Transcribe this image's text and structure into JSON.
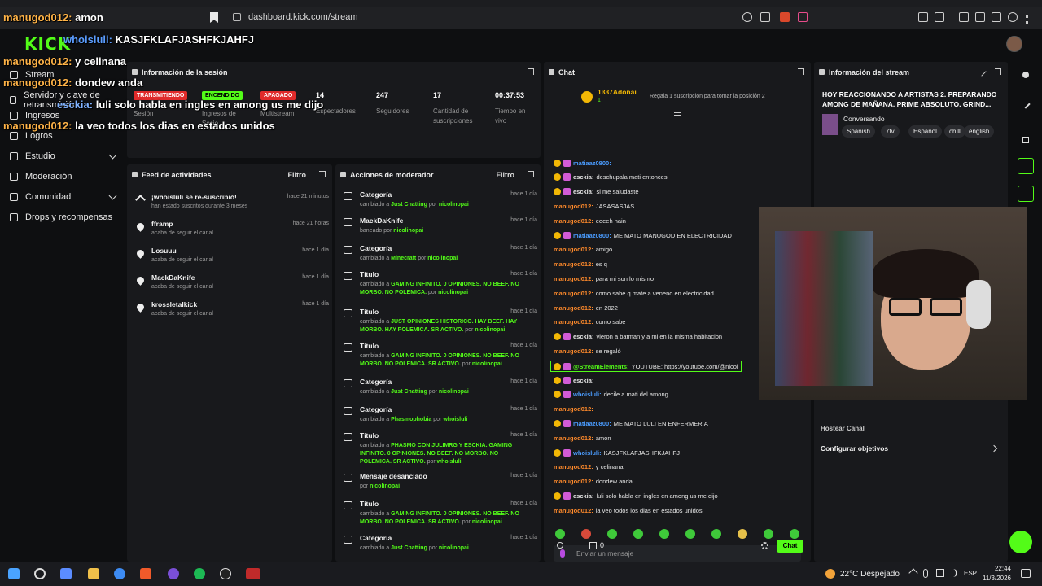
{
  "browser": {
    "url": "dashboard.kick.com/stream",
    "tab_title": "amon"
  },
  "logo": "KICK",
  "sidebar": {
    "items": [
      {
        "label": "Stream"
      },
      {
        "label": "Servidor y clave de retransmisión"
      },
      {
        "label": "Ingresos"
      },
      {
        "label": "Logros"
      },
      {
        "label": "Estudio"
      },
      {
        "label": "Moderación"
      },
      {
        "label": "Comunidad"
      },
      {
        "label": "Drops y recompensas"
      }
    ]
  },
  "session": {
    "title": "Información de la sesión",
    "badges": [
      "TRANSMITIENDO",
      "ENCENDIDO",
      "APAGADO"
    ],
    "badge_labels": [
      "Sesión",
      "Ingresos de Socio",
      "Multistream"
    ],
    "stats": [
      {
        "value": "14",
        "label": "Espectadores"
      },
      {
        "value": "247",
        "label": "Seguidores"
      },
      {
        "value": "17",
        "label": "Cantidad de suscripciones"
      },
      {
        "value": "00:37:53",
        "label": "Tiempo en vivo"
      }
    ]
  },
  "feed": {
    "title": "Feed de actividades",
    "filter_label": "Filtro",
    "items": [
      {
        "name": "¡whoisluli se re-suscribió!",
        "sub": "han estado suscritos durante 3 meses",
        "time": "hace 21 minutos"
      },
      {
        "name": "fframp",
        "sub": "acaba de seguir el canal",
        "time": "hace 21 horas"
      },
      {
        "name": "Losuuu",
        "sub": "acaba de seguir el canal",
        "time": "hace 1 día"
      },
      {
        "name": "MackDaKnife",
        "sub": "acaba de seguir el canal",
        "time": "hace 1 día"
      },
      {
        "name": "krossletalkick",
        "sub": "acaba de seguir el canal",
        "time": "hace 1 día"
      }
    ]
  },
  "mod": {
    "title": "Acciones de moderador",
    "filter_label": "Filtro",
    "items": [
      {
        "title": "Categoría",
        "pre": "cambiado a ",
        "val": "Just Chatting",
        "mid": " por ",
        "by": "nicolinopai",
        "time": "hace 1 día"
      },
      {
        "title": "MackDaKnife",
        "pre": "baneado por ",
        "val": "",
        "mid": "",
        "by": "nicolinopai",
        "time": "hace 1 día"
      },
      {
        "title": "Categoría",
        "pre": "cambiado a ",
        "val": "Minecraft",
        "mid": " por ",
        "by": "nicolinopai",
        "time": "hace 1 día"
      },
      {
        "title": "Título",
        "pre": "cambiado a ",
        "val": "GAMING INFINITO. 0 OPINIONES. NO BEEF. NO MORBO. NO POLEMICA.",
        "mid": " por ",
        "by": "nicolinopai",
        "time": "hace 1 día"
      },
      {
        "title": "Título",
        "pre": "cambiado a ",
        "val": "JUST OPINIONES HISTORICO. HAY BEEF. HAY MORBO. HAY POLEMICA. SR ACTIVO.",
        "mid": " por ",
        "by": "nicolinopai",
        "time": "hace 1 día"
      },
      {
        "title": "Título",
        "pre": "cambiado a ",
        "val": "GAMING INFINITO. 0 OPINIONES. NO BEEF. NO MORBO. NO POLEMICA. SR ACTIVO.",
        "mid": " por ",
        "by": "nicolinopai",
        "time": "hace 1 día"
      },
      {
        "title": "Categoría",
        "pre": "cambiado a ",
        "val": "Just Chatting",
        "mid": " por ",
        "by": "nicolinopai",
        "time": "hace 1 día"
      },
      {
        "title": "Categoría",
        "pre": "cambiado a ",
        "val": "Phasmophobia",
        "mid": " por ",
        "by": "whoisluli",
        "time": "hace 1 día"
      },
      {
        "title": "Título",
        "pre": "cambiado a ",
        "val": "PHASMO CON JULIMRG Y ESCKIA. GAMING INFINITO. 0 OPINIONES. NO BEEF. NO MORBO. NO POLEMICA. SR ACTIVO.",
        "mid": " por ",
        "by": "whoisluli",
        "time": "hace 1 día"
      },
      {
        "title": "Mensaje desanclado",
        "pre": "por ",
        "val": "",
        "mid": "",
        "by": "nicolinopai",
        "time": "hace 1 día"
      },
      {
        "title": "Título",
        "pre": "cambiado a ",
        "val": "GAMING INFINITO. 0 OPINIONES. NO BEEF. NO MORBO. NO POLEMICA. SR ACTIVO.",
        "mid": " por ",
        "by": "nicolinopai",
        "time": "hace 1 día"
      },
      {
        "title": "Categoría",
        "pre": "cambiado a ",
        "val": "Just Chatting",
        "mid": " por ",
        "by": "nicolinopai",
        "time": "hace 1 día"
      }
    ]
  },
  "chat": {
    "title": "Chat",
    "top_user": "1337Adonai",
    "top_rank": "1",
    "gift_text": "Regala 1 suscripción para tomar la posición 2",
    "input_placeholder": "Enviar un mensaje",
    "send_label": "Chat",
    "counter": "0",
    "messages": [
      {
        "user": "matiaaz0800:",
        "text": "",
        "color": "#4a9cff"
      },
      {
        "user": "esckia:",
        "text": "deschupala mati entonces",
        "color": "#e6e6e6"
      },
      {
        "user": "esckia:",
        "text": "si me saludaste",
        "color": "#e6e6e6"
      },
      {
        "user": "manugod012:",
        "text": "JASASASJAS",
        "color": "#ff8a2b"
      },
      {
        "user": "manugod012:",
        "text": "eeeeh nain",
        "color": "#ff8a2b"
      },
      {
        "user": "matiaaz0800:",
        "text": "ME MATO MANUGOD EN ELECTRICIDAD",
        "color": "#4a9cff"
      },
      {
        "user": "manugod012:",
        "text": "amigo",
        "color": "#ff8a2b"
      },
      {
        "user": "manugod012:",
        "text": "es q",
        "color": "#ff8a2b"
      },
      {
        "user": "manugod012:",
        "text": "para mi son lo mismo",
        "color": "#ff8a2b"
      },
      {
        "user": "manugod012:",
        "text": "como sabe q mate a veneno en electricidad",
        "color": "#ff8a2b"
      },
      {
        "user": "manugod012:",
        "text": "en 2022",
        "color": "#ff8a2b"
      },
      {
        "user": "manugod012:",
        "text": "como sabe",
        "color": "#ff8a2b"
      },
      {
        "user": "esckia:",
        "text": "vieron a batman y a mi en la misma habitacion",
        "color": "#e6e6e6"
      },
      {
        "user": "manugod012:",
        "text": "se regaló",
        "color": "#ff8a2b"
      },
      {
        "user": "@StreamElements:",
        "text": "YOUTUBE: https://youtube.com/@nicol",
        "color": "#53fc18"
      },
      {
        "user": "esckia:",
        "text": "",
        "color": "#e6e6e6"
      },
      {
        "user": "whoisluli:",
        "text": "decile a mati del among",
        "color": "#4a9cff"
      },
      {
        "user": "manugod012:",
        "text": "",
        "color": "#ff8a2b"
      },
      {
        "user": "matiaaz0800:",
        "text": "ME MATO LULI EN ENFERMERIA",
        "color": "#4a9cff"
      },
      {
        "user": "manugod012:",
        "text": "amon",
        "color": "#ff8a2b"
      },
      {
        "user": "whoisluli:",
        "text": "KASJFKLAFJASHFKJAHFJ",
        "color": "#4a9cff"
      },
      {
        "user": "manugod012:",
        "text": "y celinana",
        "color": "#ff8a2b"
      },
      {
        "user": "manugod012:",
        "text": "dondew anda",
        "color": "#ff8a2b"
      },
      {
        "user": "esckia:",
        "text": "luli solo habla en ingles en among us me dijo",
        "color": "#e6e6e6"
      },
      {
        "user": "manugod012:",
        "text": "la veo todos los dias en estados unidos",
        "color": "#ff8a2b"
      }
    ]
  },
  "stream_info": {
    "title": "Información del stream",
    "stream_title": "HOY REACCIONANDO A ARTISTAS 2. PREPARANDO AMONG DE MAÑANA. PRIME ABSOLUTO. GRIND...",
    "category": "Conversando",
    "tags": [
      "Spanish",
      "7tv",
      "Español",
      "chill",
      "english"
    ],
    "host_label": "Hostear Canal",
    "goals_label": "Configurar objetivos"
  },
  "overlay": {
    "lines": [
      {
        "name": "manugod012:",
        "text": " amon"
      },
      {
        "name": "whoisluli:",
        "text": " KASJFKLAFJASHFKJAHFJ"
      },
      {
        "name": "manugod012:",
        "text": " y celinana"
      },
      {
        "name": "manugod012:",
        "text": " dondew anda"
      },
      {
        "name": "esckia:",
        "text": " luli solo habla en ingles en among us me dijo"
      },
      {
        "name": "manugod012:",
        "text": " la veo todos los dias en estados unidos"
      }
    ]
  },
  "taskbar": {
    "weather": "22°C  Despejado",
    "lang": "ESP",
    "time": "22:44",
    "date": "11/3/2026"
  }
}
